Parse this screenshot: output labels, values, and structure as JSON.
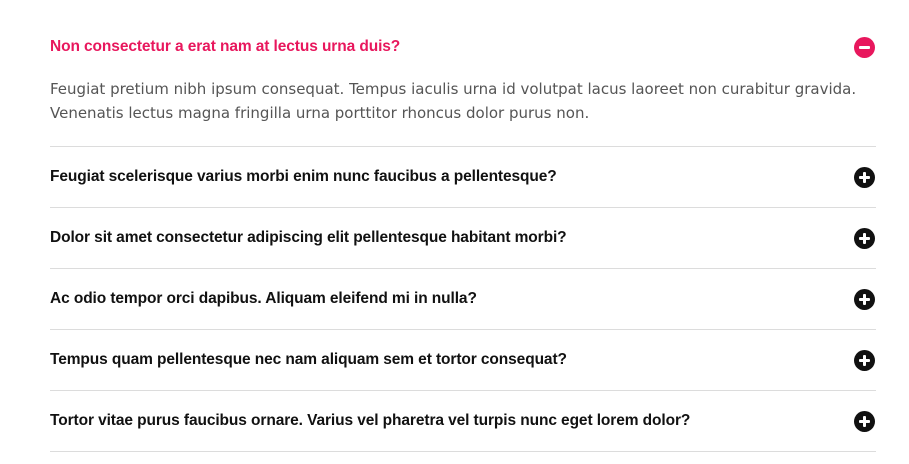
{
  "faq": {
    "items": [
      {
        "question": "Non consectetur a erat nam at lectus urna duis?",
        "answer": "Feugiat pretium nibh ipsum consequat. Tempus iaculis urna id volutpat lacus laoreet non curabitur gravida. Venenatis lectus magna fringilla urna porttitor rhoncus dolor purus non.",
        "expanded": true,
        "icon": "minus-circle-icon"
      },
      {
        "question": "Feugiat scelerisque varius morbi enim nunc faucibus a pellentesque?",
        "expanded": false,
        "icon": "plus-circle-icon"
      },
      {
        "question": "Dolor sit amet consectetur adipiscing elit pellentesque habitant morbi?",
        "expanded": false,
        "icon": "plus-circle-icon"
      },
      {
        "question": "Ac odio tempor orci dapibus. Aliquam eleifend mi in nulla?",
        "expanded": false,
        "icon": "plus-circle-icon"
      },
      {
        "question": "Tempus quam pellentesque nec nam aliquam sem et tortor consequat?",
        "expanded": false,
        "icon": "plus-circle-icon"
      },
      {
        "question": "Tortor vitae purus faucibus ornare. Varius vel pharetra vel turpis nunc eget lorem dolor?",
        "expanded": false,
        "icon": "plus-circle-icon"
      }
    ]
  },
  "colors": {
    "accent": "#e8175d",
    "text": "#111111",
    "body_text": "#555555",
    "divider": "#dcdcdc"
  }
}
